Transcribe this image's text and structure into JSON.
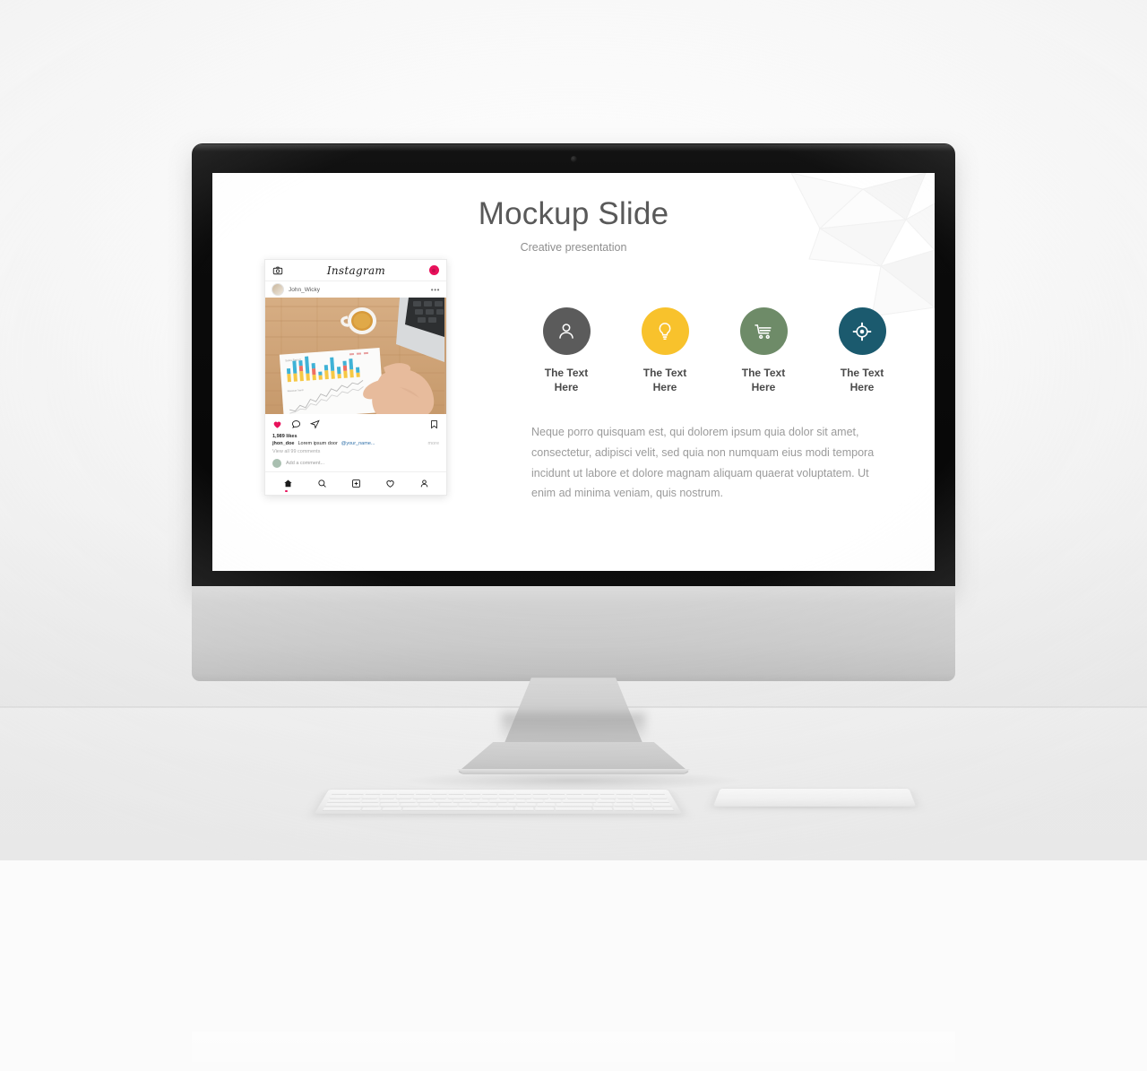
{
  "scene": {
    "device": "imac-desktop-monitor",
    "accessories": [
      "keyboard",
      "trackpad"
    ]
  },
  "slide": {
    "title": "Mockup Slide",
    "subtitle": "Creative presentation",
    "decoration": "low-poly-geometric-watermark",
    "features": [
      {
        "icon": "person-icon",
        "color": "#5B5B5B",
        "line1": "The Text",
        "line2": "Here"
      },
      {
        "icon": "lightbulb-icon",
        "color": "#F8C22C",
        "line1": "The Text",
        "line2": "Here"
      },
      {
        "icon": "shopping-cart-icon",
        "color": "#6E8B68",
        "line1": "The Text",
        "line2": "Here"
      },
      {
        "icon": "target-icon",
        "color": "#1B5A6E",
        "line1": "The Text",
        "line2": "Here"
      }
    ],
    "body": "Neque porro quisquam est, qui dolorem ipsum quia dolor sit amet, consectetur, adipisci velit, sed quia non numquam eius modi tempora incidunt ut labore et dolore magnam aliquam quaerat voluptatem. Ut enim ad minima veniam, quis nostrum."
  },
  "instagram": {
    "logo": "Instagram",
    "camera_icon": "camera-icon",
    "badge_icon": "activity-badge",
    "username": "John_Wicky",
    "more_menu": "•••",
    "photo_alt": "desk-with-coffee-laptop-and-chart-report",
    "likes": "1,989 likes",
    "caption_user": "jhon_doe",
    "caption_text": "Lorem ipsum door",
    "caption_tag": "@your_name...",
    "caption_more": "more",
    "view_comments": "View all 99 comments",
    "add_comment_placeholder": "Add a comment...",
    "actions": [
      "heart-icon",
      "comment-icon",
      "share-icon",
      "bookmark-icon"
    ],
    "nav": [
      "home-icon",
      "search-icon",
      "add-post-icon",
      "activity-heart-icon",
      "profile-icon"
    ]
  },
  "photo_chart": {
    "type": "bar",
    "title": "Sales Report",
    "bars": [
      {
        "blue": 18,
        "red": 0,
        "yellow": 22
      },
      {
        "blue": 36,
        "red": 6,
        "yellow": 20
      },
      {
        "blue": 30,
        "red": 10,
        "yellow": 26
      },
      {
        "blue": 46,
        "red": 0,
        "yellow": 18
      },
      {
        "blue": 28,
        "red": 8,
        "yellow": 14
      },
      {
        "blue": 10,
        "red": 0,
        "yellow": 12
      },
      {
        "blue": 24,
        "red": 0,
        "yellow": 24
      },
      {
        "blue": 40,
        "red": 6,
        "yellow": 20
      },
      {
        "blue": 20,
        "red": 0,
        "yellow": 10
      },
      {
        "blue": 16,
        "red": 14,
        "yellow": 18
      },
      {
        "blue": 34,
        "red": 0,
        "yellow": 22
      },
      {
        "blue": 14,
        "red": 0,
        "yellow": 10
      }
    ],
    "colors": {
      "blue": "#3FB2D6",
      "red": "#EE6E63",
      "yellow": "#F6C844"
    },
    "line_series": [
      8,
      4,
      12,
      9,
      18,
      14,
      24,
      20,
      30,
      26,
      34,
      31,
      38
    ]
  }
}
